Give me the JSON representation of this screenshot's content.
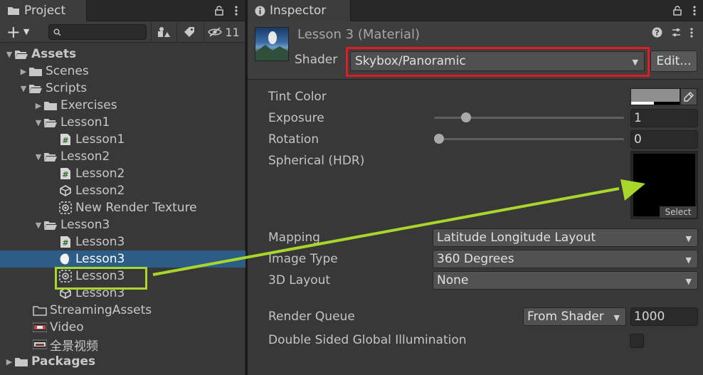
{
  "project": {
    "tab_label": "Project",
    "hidden_count": "11",
    "search_placeholder": "",
    "tree": [
      {
        "label": "Assets"
      },
      {
        "label": "Scenes"
      },
      {
        "label": "Scripts"
      },
      {
        "label": "Exercises"
      },
      {
        "label": "Lesson1"
      },
      {
        "label": "Lesson1"
      },
      {
        "label": "Lesson2"
      },
      {
        "label": "Lesson2"
      },
      {
        "label": "Lesson2"
      },
      {
        "label": "New Render Texture"
      },
      {
        "label": "Lesson3"
      },
      {
        "label": "Lesson3"
      },
      {
        "label": "Lesson3"
      },
      {
        "label": "Lesson3"
      },
      {
        "label": "Lesson3"
      },
      {
        "label": "StreamingAssets"
      },
      {
        "label": "Video"
      },
      {
        "label": "全景视频"
      },
      {
        "label": "Packages"
      }
    ]
  },
  "inspector": {
    "tab_label": "Inspector",
    "material_title": "Lesson 3 (Material)",
    "shader_label": "Shader",
    "shader_value": "Skybox/Panoramic",
    "edit_label": "Edit...",
    "tint_color_label": "Tint Color",
    "tint_color_hex": "#8f8f8f",
    "exposure_label": "Exposure",
    "exposure_value": "1",
    "exposure_fraction": 0.15,
    "rotation_label": "Rotation",
    "rotation_value": "0",
    "rotation_fraction": 0.0,
    "spherical_label": "Spherical  (HDR)",
    "select_label": "Select",
    "mapping_label": "Mapping",
    "mapping_value": "Latitude Longitude Layout",
    "image_type_label": "Image Type",
    "image_type_value": "360 Degrees",
    "layout_3d_label": "3D Layout",
    "layout_3d_value": "None",
    "render_queue_label": "Render Queue",
    "render_queue_mode": "From Shader",
    "render_queue_value": "1000",
    "double_sided_label": "Double Sided Global Illumination",
    "double_sided_checked": false
  },
  "colors": {
    "selection": "#2c5d87",
    "annotation_red": "#e01b24",
    "annotation_green": "#a8d62a"
  }
}
